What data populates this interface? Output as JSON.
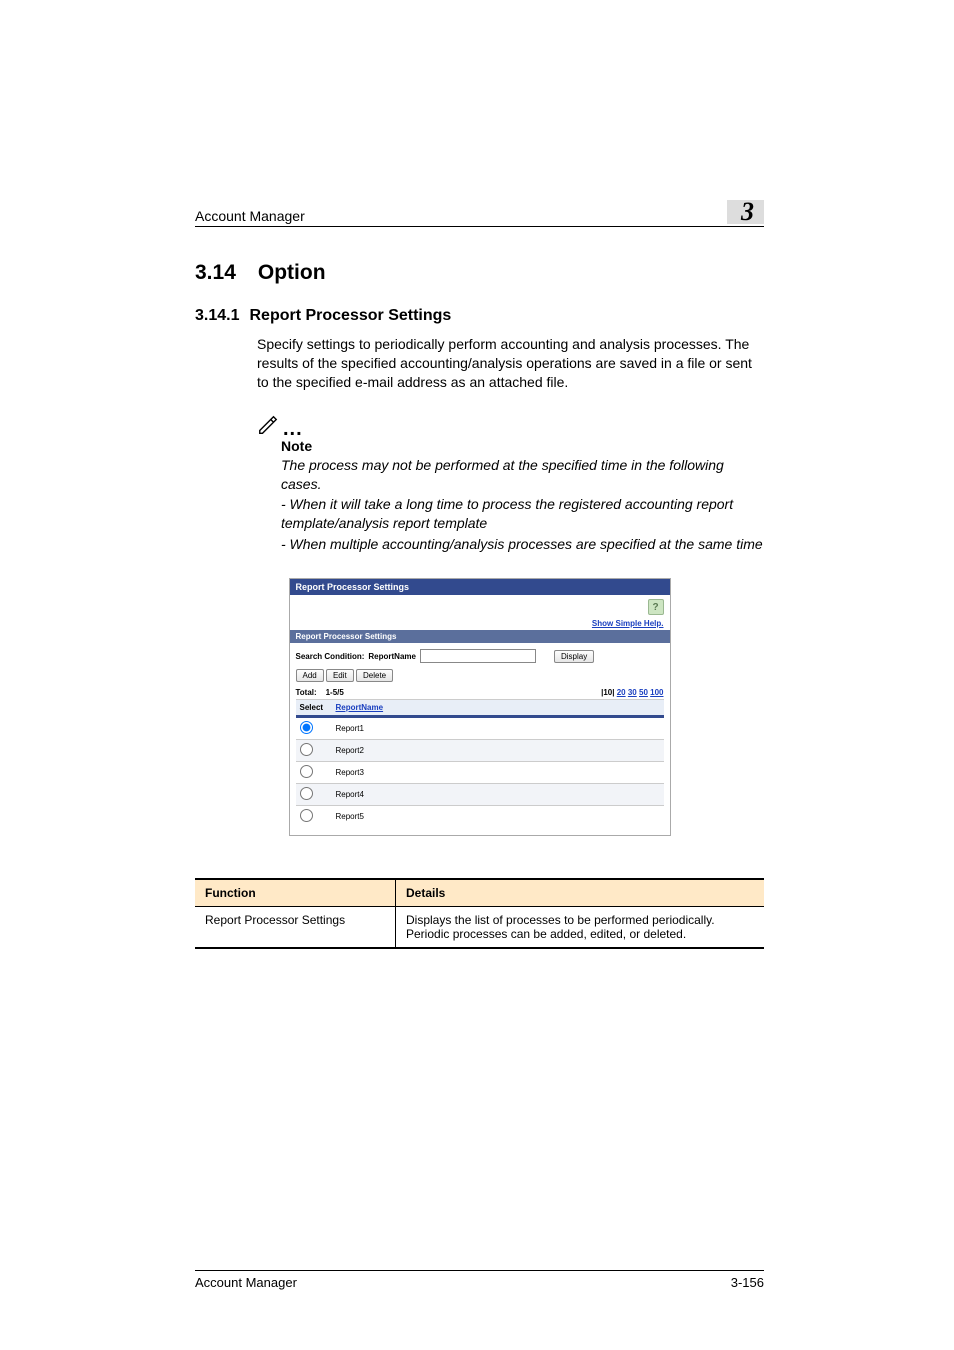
{
  "header": {
    "section_title": "Account Manager",
    "chapter_number": "3"
  },
  "section": {
    "number": "3.14",
    "title": "Option",
    "sub_number": "3.14.1",
    "sub_title": "Report Processor Settings",
    "body": "Specify settings to periodically perform accounting and analysis processes. The results of the specified accounting/analysis operations are saved in a file or sent to the specified e-mail address as an attached file."
  },
  "note": {
    "label": "Note",
    "p1": "The process may not be performed at the specified time in the following cases.",
    "p2": "- When it will take a long time to process the registered accounting report template/analysis report template",
    "p3": "- When multiple accounting/analysis processes are specified at the same time"
  },
  "screenshot": {
    "title": "Report Processor Settings",
    "help_icon": "?",
    "help_link": "Show Simple Help.",
    "subtitle": "Report Processor Settings",
    "search_label": "Search Condition:",
    "search_field_label": "ReportName",
    "display_btn": "Display",
    "add_btn": "Add",
    "edit_btn": "Edit",
    "delete_btn": "Delete",
    "total_label": "Total:",
    "total_value": "1-5/5",
    "pager": {
      "p10": "10",
      "p20": "20",
      "p30": "30",
      "p50": "50",
      "p100": "100"
    },
    "col_select": "Select",
    "col_reportname": "ReportName",
    "rows": {
      "r1": "Report1",
      "r2": "Report2",
      "r3": "Report3",
      "r4": "Report4",
      "r5": "Report5"
    }
  },
  "func_table": {
    "h1": "Function",
    "h2": "Details",
    "r1_fn": "Report Processor Settings",
    "r1_det": "Displays the list of processes to be performed periodically. Periodic processes can be added, edited, or deleted."
  },
  "chart_data": {
    "type": "table",
    "columns": [
      "Function",
      "Details"
    ],
    "rows": [
      [
        "Report Processor Settings",
        "Displays the list of processes to be performed periodically. Periodic processes can be added, edited, or deleted."
      ]
    ]
  },
  "footer": {
    "left": "Account Manager",
    "right": "3-156"
  }
}
